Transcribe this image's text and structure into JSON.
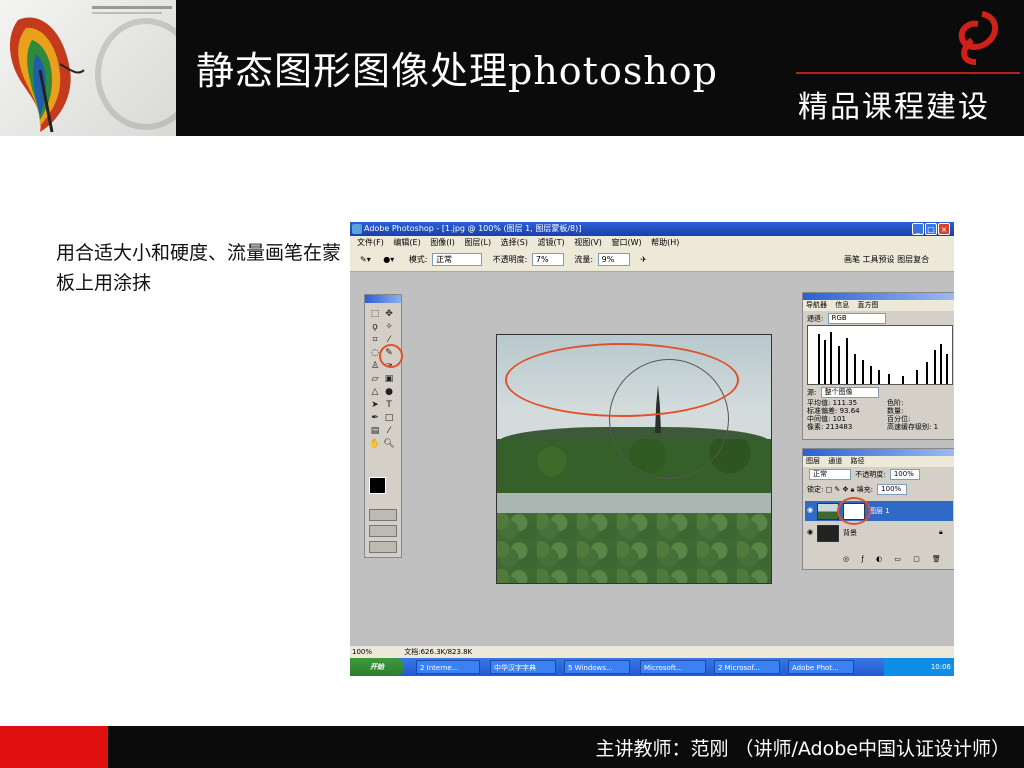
{
  "header": {
    "title": "静态图形图像处理photoshop",
    "course_label": "精品课程建设"
  },
  "instruction": "用合适大小和硬度、流量画笔在蒙板上用涂抹",
  "photoshop": {
    "window_title": "Adobe Photoshop - [1.jpg @ 100% (图层 1, 图层蒙板/8)]",
    "menu": [
      "文件(F)",
      "编辑(E)",
      "图像(I)",
      "图层(L)",
      "选择(S)",
      "滤镜(T)",
      "视图(V)",
      "窗口(W)",
      "帮助(H)"
    ],
    "options": {
      "mode_label": "模式:",
      "mode_value": "正常",
      "opacity_label": "不透明度:",
      "opacity_value": "7%",
      "flow_label": "流量:",
      "flow_value": "9%"
    },
    "palette_tabs": [
      "画笔",
      "工具预设",
      "图层复合"
    ],
    "histogram_panel": {
      "tabs": [
        "导航器",
        "信息",
        "直方图"
      ],
      "channel_label": "通道:",
      "channel_value": "RGB",
      "source_label": "源:",
      "source_value": "整个图像",
      "stats": [
        "平均值: 111.35",
        "标准偏差: 93.64",
        "中间值: 101",
        "像素: 213483"
      ],
      "stats_right": [
        "色阶:",
        "数量:",
        "百分位:",
        "高速缓存级别: 1"
      ]
    },
    "layers_panel": {
      "tabs": [
        "图层",
        "通道",
        "路径"
      ],
      "blend_value": "正常",
      "opacity_label": "不透明度:",
      "opacity_value": "100%",
      "lock_label": "锁定:",
      "fill_label": "填充:",
      "fill_value": "100%",
      "layers": [
        {
          "name": "图层 1",
          "selected": true
        },
        {
          "name": "背景",
          "selected": false
        }
      ]
    },
    "status": {
      "zoom": "100%",
      "doc": "文档:626.3K/823.8K"
    },
    "taskbar": {
      "start": "开始",
      "items": [
        "2 Interne...",
        "中华汉字字典",
        "5 Windows...",
        "Microsoft...",
        "2 Microsof...",
        "Adobe Phot..."
      ],
      "clock": "10:06"
    }
  },
  "footer": {
    "text": "主讲教师：范刚  （讲师/Adobe中国认证设计师）"
  },
  "colors": {
    "header_bg": "#0b0b0b",
    "accent_red": "#e00f0f",
    "highlight_orange": "#e0502a"
  }
}
